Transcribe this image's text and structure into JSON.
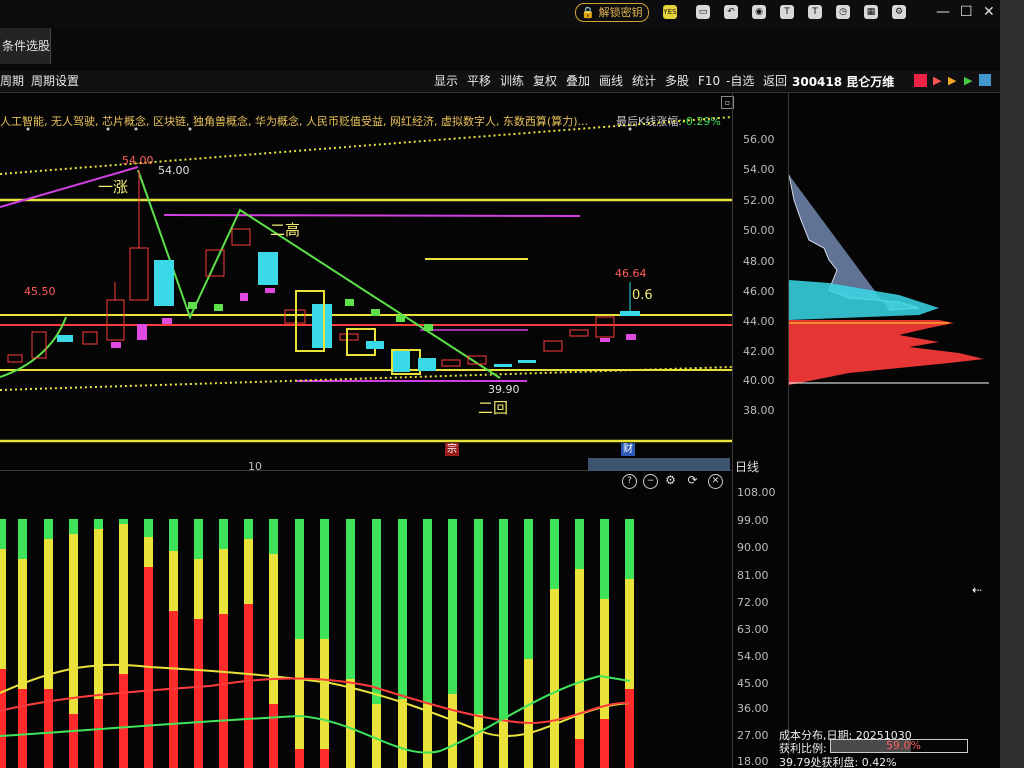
{
  "titlebar": {
    "unlock_label": "解锁密钥",
    "yes_badge": "YES"
  },
  "tabs": [
    {
      "label": "条件选股"
    }
  ],
  "toolbar": {
    "left": [
      "周期",
      "周期设置"
    ],
    "right": [
      "显示",
      "平移",
      "训练",
      "复权",
      "叠加",
      "画线",
      "统计",
      "多股",
      "F10",
      "-自选",
      "返回"
    ],
    "stock_code": "300418",
    "stock_name": "昆仑万维"
  },
  "concepts_text": "人工智能, 无人驾驶, 芯片概念, 区块链, 独角兽概念, 华为概念, 人民币贬值受益, 网红经济, 虚拟数字人, 东数西算(算力)...",
  "last_k": {
    "label": "最后K线涨幅:",
    "value": "-0.29%"
  },
  "price_axis": [
    "56.00",
    "54.00",
    "52.00",
    "50.00",
    "48.00",
    "46.00",
    "44.00",
    "42.00",
    "40.00",
    "38.00"
  ],
  "volume_axis": [
    "108.00",
    "99.00",
    "90.00",
    "81.00",
    "72.00",
    "63.00",
    "54.00",
    "45.00",
    "36.00",
    "27.00",
    "18.00"
  ],
  "annotations": {
    "high1": "54.00",
    "high1b": "54.00",
    "left_price": "45.50",
    "peak_right": "46.64",
    "low": "39.90",
    "yi_zhang": "一涨",
    "er_gao": "二高",
    "er_hui": "二回",
    "ratio_mark": "0.6"
  },
  "date_label": "10",
  "period_label": "日线",
  "tags": {
    "zong": "宗",
    "cai": "财"
  },
  "cost_panel": {
    "date_line": "成本分布,日期: 20251030",
    "ratio_label": "获利比例:",
    "ratio_value": "59.0%",
    "ratio_fraction": 0.59,
    "profit_line": "39.79处获利盘: 0.42%"
  },
  "colors": {
    "up": "#ff3b3b",
    "down": "#39d9e8",
    "yellow": "#e8e23a",
    "magenta": "#d13fe0",
    "green": "#3ee35a"
  }
}
